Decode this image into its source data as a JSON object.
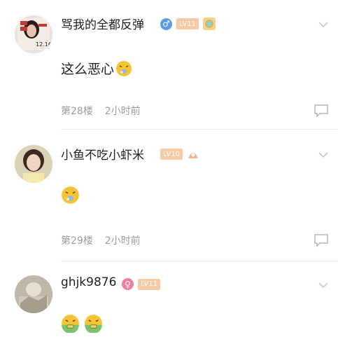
{
  "comments": [
    {
      "username": "骂我的全都反弹",
      "gender": "male",
      "gender_symbol": "♂",
      "gender_color": "#5a9de6",
      "level": "LV11",
      "text": "这么恶心",
      "emoji": "vomit-face",
      "floor": "第28楼",
      "time": "2小时前",
      "avatar_text": "12.16"
    },
    {
      "username": "小鱼不吃小虾米",
      "gender": "none",
      "level": "LV10",
      "text": "",
      "emoji": "vomit-face",
      "floor": "第29楼",
      "time": "2小时前"
    },
    {
      "username": "ghjk9876",
      "gender": "female",
      "gender_symbol": "♀",
      "gender_color": "#f07ea0",
      "level": "LV11",
      "text": "",
      "emoji": "sick-face",
      "emoji_count": 2
    }
  ],
  "colors": {
    "level_badge": "#f7c9a4",
    "meta_text": "#9c9c9c",
    "icon_gray": "#c7c7c7"
  }
}
